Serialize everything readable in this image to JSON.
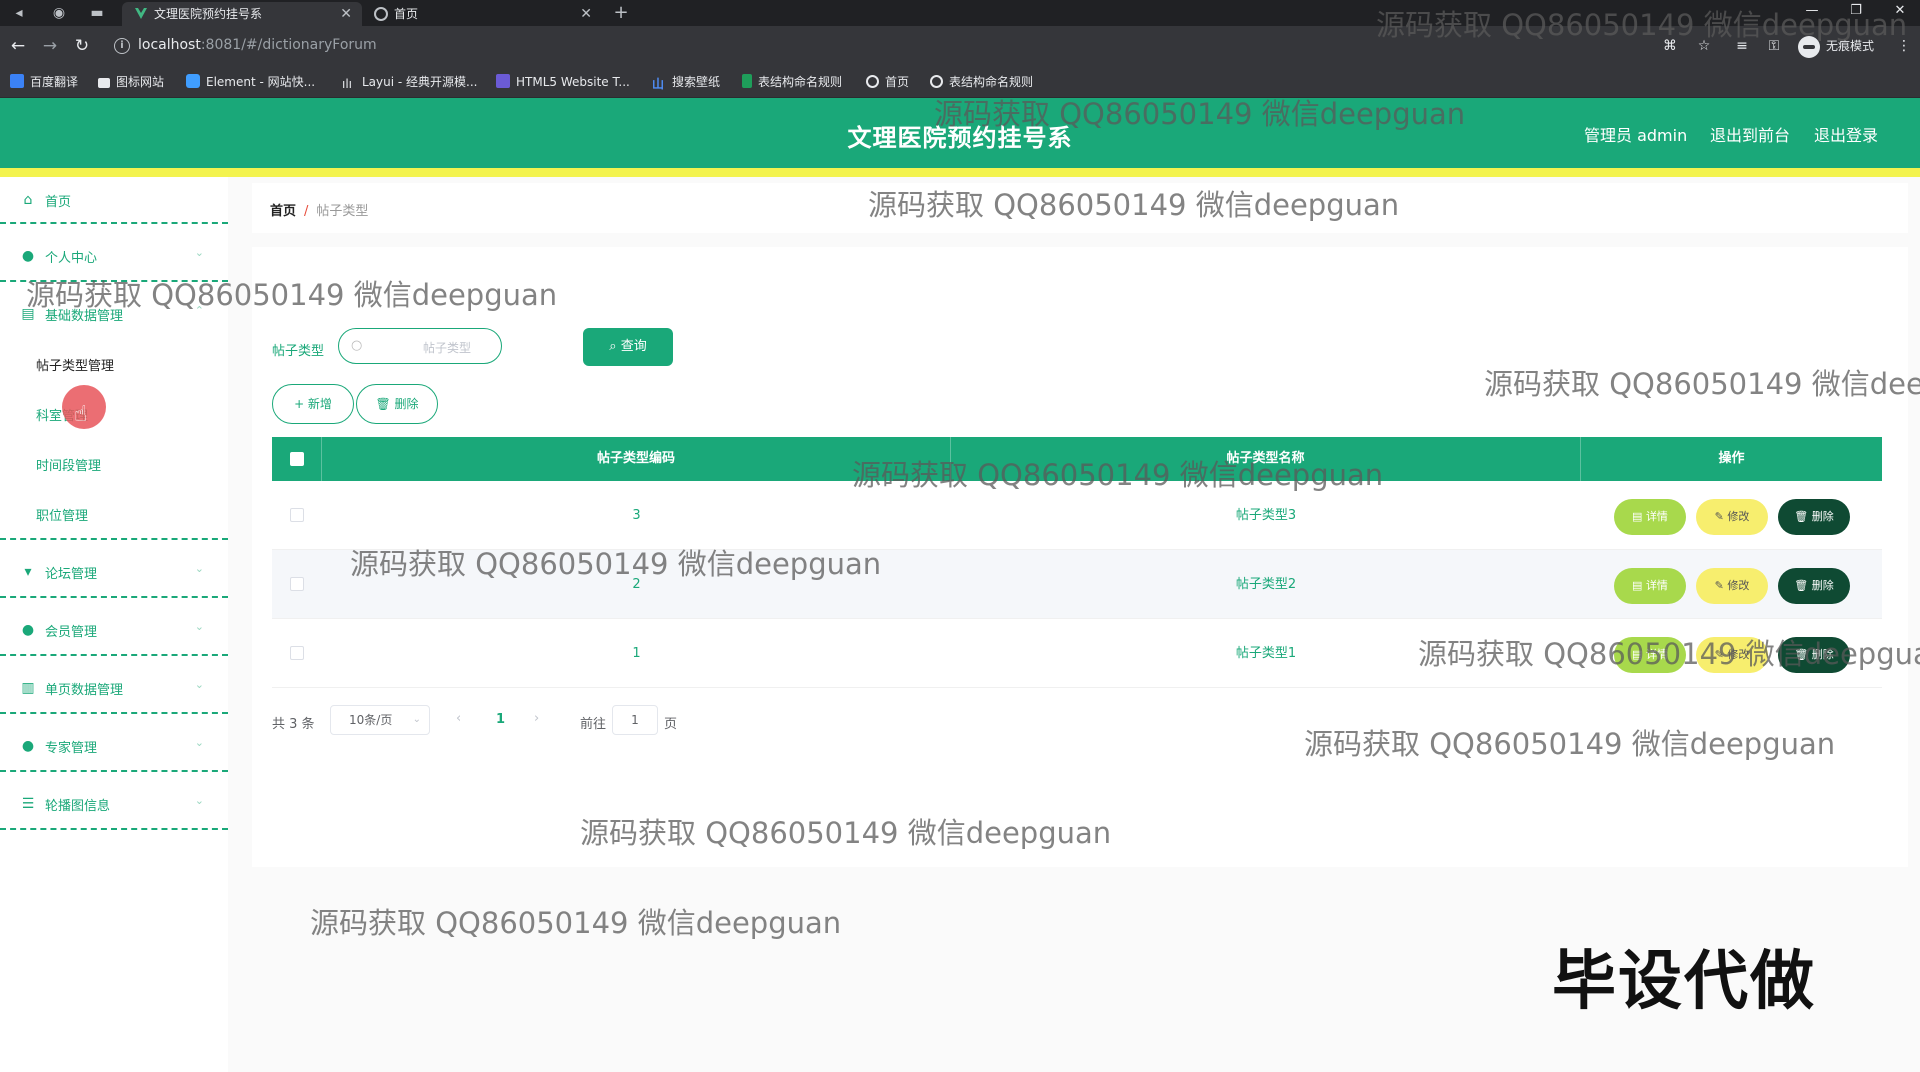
{
  "browser": {
    "tabs": [
      {
        "title": "文理医院预约挂号系",
        "active": true
      },
      {
        "title": "首页",
        "active": false
      }
    ],
    "url_host": "localhost",
    "url_rest": ":8081/#/dictionaryForum",
    "incognito_label": "无痕模式",
    "bookmarks": [
      "百度翻译",
      "图标网站",
      "Element - 网站快...",
      "Layui - 经典开源模...",
      "HTML5 Website T...",
      "搜索壁纸",
      "表结构命名规则",
      "首页",
      "表结构命名规则"
    ]
  },
  "header": {
    "title": "文理医院预约挂号系",
    "user": "管理员 admin",
    "front_link": "退出到前台",
    "logout": "退出登录"
  },
  "sidebar": {
    "home": "首页",
    "personal": "个人中心",
    "basic": "基础数据管理",
    "basic_sub": [
      "帖子类型管理",
      "科室管理",
      "时间段管理",
      "职位管理"
    ],
    "forum": "论坛管理",
    "member": "会员管理",
    "single": "单页数据管理",
    "expert": "专家管理",
    "carousel": "轮播图信息"
  },
  "breadcrumb": {
    "home": "首页",
    "separator": "/",
    "current": "帖子类型"
  },
  "search": {
    "label": "帖子类型",
    "placeholder": "帖子类型",
    "query_button": "查询"
  },
  "actions": {
    "add": "+ 新增",
    "delete": "删除"
  },
  "table": {
    "columns": [
      "帖子类型编码",
      "帖子类型名称",
      "操作"
    ],
    "rows": [
      {
        "code": "3",
        "name": "帖子类型3"
      },
      {
        "code": "2",
        "name": "帖子类型2"
      },
      {
        "code": "1",
        "name": "帖子类型1"
      }
    ],
    "op_detail": "详情",
    "op_edit": "修改",
    "op_delete": "删除"
  },
  "pagination": {
    "total": "共 3 条",
    "page_size": "10条/页",
    "current_page": "1",
    "goto_label": "前往",
    "goto_value": "1",
    "page_unit": "页"
  },
  "watermark": "源码获取 QQ86050149 微信deepguan",
  "stamp": "毕设代做",
  "colors": {
    "primary": "#1aa879",
    "accent_yellow": "#f3f34e",
    "detail": "#a8d94c",
    "edit": "#f7ee6e",
    "delete": "#0f4a33"
  }
}
